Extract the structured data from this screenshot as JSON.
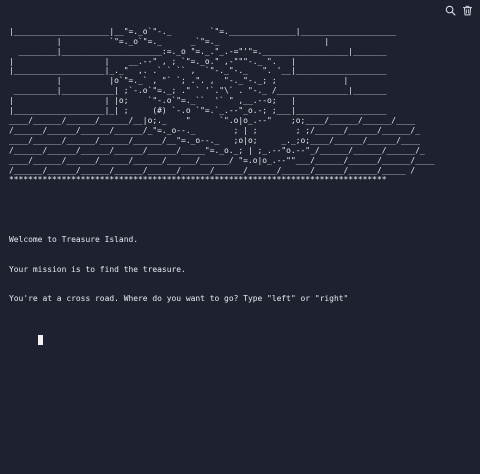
{
  "toolbar": {
    "search_icon": "search-icon",
    "trash_icon": "trash-icon"
  },
  "console": {
    "ascii_art": "|____________________|__\"=._o`\"-._        `\"=.______________|____________________\n          |          `\"=._o`\"=._      _`\"=._                      |\n  ________|_____________________:=._o \"=._.\"_.-=\"'\"=.__________________|_______\n|                   |    __.--\" , ; `\"=._o.\" ,-\"\"\"-._ \".   |\n|___________________|_._\"  ,. .` ` `` ,  `\"-._\"-._   \". '__|___________________\n          |          |o`\"=._` , \"` `; .\". ,  \"-._\"-._; ;              |\n _________|___________| ;`-.o`\"=._; .\" ` '`.\"\\` . \"-._ /_______________|_______\n|                   | |o;    `\"-.o`\"=._``  '` \" ,__.--o;   |\n|___________________|_| ;     (#) `-.o `\"=.`_.--\"_o.-; ;___|___________________\n____/______/______/______/__|o;._    \"      `\".o|o_.--\"    ;o;____/______/______/____\n/______/______/______/______/_\"=._o--._        ; | ;        ; ;/______/______/______/_\n____/______/______/______/______/__\"=._o--._   ;o|o;     _._;o;____/______/______/____\n/______/______/______/______/______/_____\"=._o._; | ;_.--\"o.--\"_/______/______/______/_\n____/______/______/______/______/______/______/ \"=.o|o_.--\"\"___/______/______/______/____\n/______/______/______/______/______/______/______/______/______/______/______/_____ /\n*******************************************************************************",
    "lines": [
      "Welcome to Treasure Island.",
      "Your mission is to find the treasure.",
      "You're at a cross road. Where do you want to go? Type \"left\" or \"right\""
    ]
  }
}
